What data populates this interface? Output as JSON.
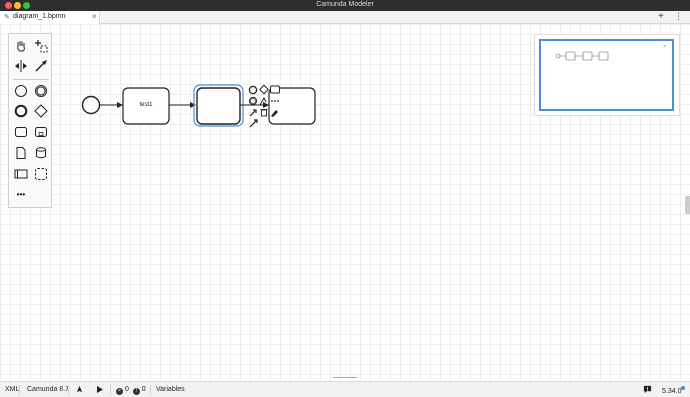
{
  "window": {
    "title": "Camunda Modeler"
  },
  "tabs": [
    {
      "label": "diagram_1.bpmn",
      "close": "×",
      "active": true
    }
  ],
  "tabbar": {
    "add_label": "+",
    "more_label": "⋮"
  },
  "palette": {
    "tools": [
      "hand-tool",
      "lasso-tool",
      "space-tool",
      "global-connect-tool"
    ],
    "elements": [
      "start-event",
      "intermediate-event",
      "end-event",
      "gateway",
      "task",
      "subprocess",
      "data-object",
      "data-store",
      "pool",
      "group"
    ],
    "more_label": "•••"
  },
  "diagram": {
    "tasks": [
      {
        "label": "test1",
        "selected": false
      },
      {
        "label": "",
        "selected": true
      },
      {
        "label": "",
        "selected": false
      }
    ]
  },
  "minimap": {
    "close_label": "×"
  },
  "statusbar": {
    "format": "XML",
    "engine": "Camunda 8.7",
    "errors": "0",
    "warnings": "0",
    "variables_label": "Variables",
    "version": "5.34.0"
  },
  "colors": {
    "accent": "#4a8fd6",
    "titlebar": "#2e2e2e",
    "selection": "#4a8fd6"
  }
}
